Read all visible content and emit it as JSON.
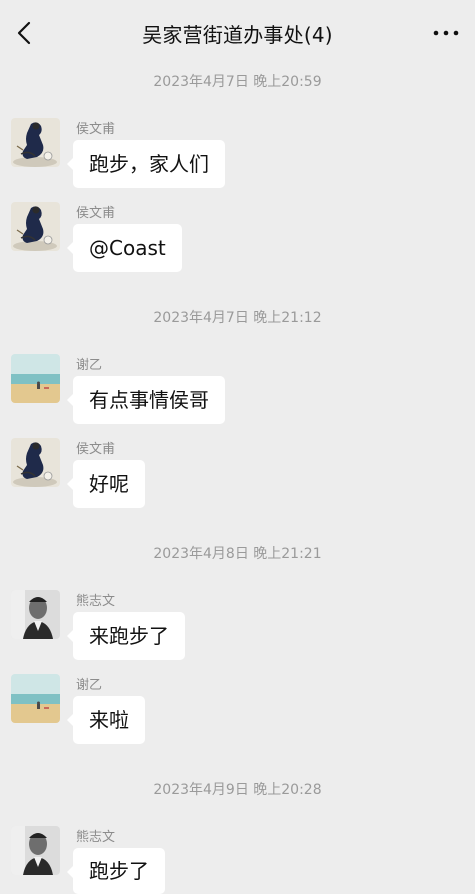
{
  "header": {
    "title": "吴家营街道办事处(4)"
  },
  "messages": [
    {
      "sender": "侯文甫",
      "text": "跑步，家人们",
      "avatar": "ink-figure-avatar"
    },
    {
      "sender": "侯文甫",
      "text": "@Coast",
      "avatar": "ink-figure-avatar"
    },
    {
      "sender": "谢乙",
      "text": "有点事情侯哥",
      "avatar": "beach-avatar"
    },
    {
      "sender": "侯文甫",
      "text": "好呢",
      "avatar": "ink-figure-avatar"
    },
    {
      "sender": "熊志文",
      "text": "来跑步了",
      "avatar": "portrait-avatar"
    },
    {
      "sender": "谢乙",
      "text": "来啦",
      "avatar": "beach-avatar"
    },
    {
      "sender": "熊志文",
      "text": "跑步了",
      "avatar": "portrait-avatar"
    }
  ],
  "timestamps": [
    "2023年4月7日 晚上20:59",
    "2023年4月7日 晚上21:12",
    "2023年4月8日 晚上21:21",
    "2023年4月9日 晚上20:28"
  ],
  "colors": {
    "background": "#ededed",
    "bubble": "#ffffff",
    "timestamp_text": "#9a9a9a",
    "sender_text": "#8c8c8c"
  }
}
